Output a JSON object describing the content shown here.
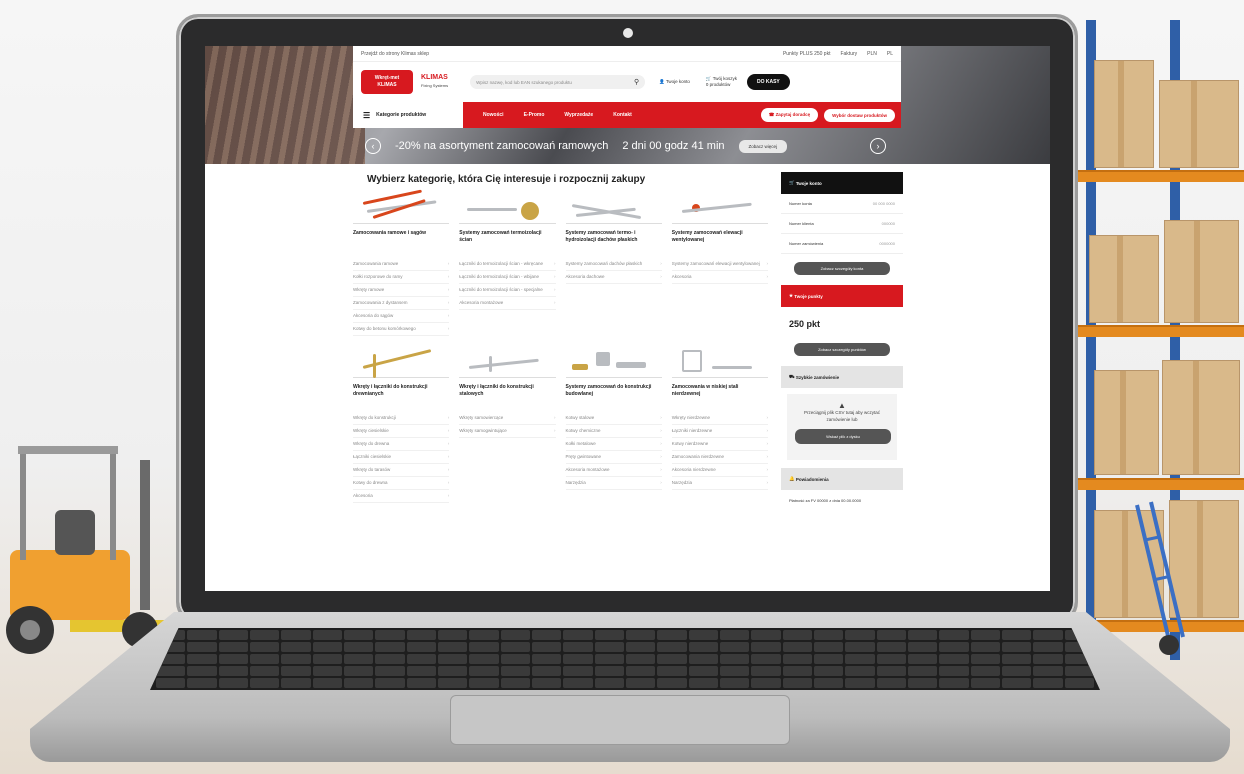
{
  "site": {
    "topbar": {
      "left": "Przejdź do strony Klimas sklep",
      "items": [
        "Punkty PLUS 250 pkt",
        "Faktury",
        "PLN",
        "PL"
      ]
    },
    "logo_main_line1": "Wkręt-met",
    "logo_main_line2": "KLIMAS",
    "logo_secondary": "KLIMAS",
    "logo_secondary_sub": "Fixing Systems",
    "search_placeholder": "Wpisz nazwę, kod lub EAN szukanego produktu",
    "account_link": "Twoje konto",
    "cart_line1": "Twój koszyk",
    "cart_line2": "0 produktów",
    "checkout_button": "DO KASY",
    "nav": {
      "categories_label": "Kategorie produktów",
      "links": [
        "Nowości",
        "E-Promo",
        "Wyprzedaże",
        "Kontakt"
      ],
      "pill_1": "Zapytaj doradcę",
      "pill_2": "Wybór dostaw produktów"
    },
    "promo": {
      "text": "-20% na asortyment zamocowań ramowych",
      "countdown": "2 dni 00 godz 41 min",
      "button": "Zobacz więcej"
    }
  },
  "main": {
    "title": "Wybierz kategorię, która Cię interesuje i rozpocznij zakupy",
    "categories_row1": [
      {
        "title": "Zamocowania ramowe i sągów",
        "items": [
          "Zamocowania ramowe",
          "Kołki rozporowe do ramy",
          "Wkręty ramowe",
          "Zamocowania z dystansem",
          "Akcesoria do sągów",
          "Kotwy do betonu komórkowego"
        ]
      },
      {
        "title": "Systemy zamocowań termoizolacji ścian",
        "items": [
          "Łączniki do termoizolacji ścian - wkręcane",
          "Łączniki do termoizolacji ścian - wbijane",
          "Łączniki do termoizolacji ścian - specjalne",
          "Akcesoria montażowe"
        ]
      },
      {
        "title": "Systemy zamocowań termo- i hydroizolacji dachów płaskich",
        "items": [
          "Systemy zamocowań dachów płaskich",
          "Akcesoria dachowe"
        ]
      },
      {
        "title": "Systemy zamocowań elewacji wentylowanej",
        "items": [
          "Systemy zamocowań elewacji wentylowanej",
          "Akcesoria"
        ]
      }
    ],
    "categories_row2": [
      {
        "title": "Wkręty i łączniki do konstrukcji drewnianych",
        "items": [
          "Wkręty do konstrukcji",
          "Wkręty ciesielskie",
          "Wkręty do drewna",
          "Łączniki ciesielskie",
          "Wkręty do tarasów",
          "Kotwy do drewna",
          "Akcesoria"
        ]
      },
      {
        "title": "Wkręty i łączniki do konstrukcji stalowych",
        "items": [
          "Wkręty samowiercące",
          "Wkręty samogwintujące"
        ]
      },
      {
        "title": "Systemy zamocowań do konstrukcji budowlanej",
        "items": [
          "Kotwy stalowe",
          "Kotwy chemiczne",
          "Kołki metalowe",
          "Pręty gwintowane",
          "Akcesoria montażowe",
          "Narzędzia"
        ]
      },
      {
        "title": "Zamocowania w niskiej stali nierdzewnej",
        "items": [
          "Wkręty nierdzewne",
          "Łączniki nierdzewne",
          "Kotwy nierdzewne",
          "Zamocowania nierdzewne",
          "Akcesoria nierdzewne",
          "Narzędzia"
        ]
      }
    ]
  },
  "sidebar": {
    "account_header": "Twoje konto",
    "rows": [
      {
        "label": "Numer konta",
        "value": "00 000 0000"
      },
      {
        "label": "Numer klienta",
        "value": "000000"
      },
      {
        "label": "Numer zamówienia",
        "value": "0000000"
      }
    ],
    "account_button": "Zobacz szczegóły konta",
    "points_header": "Twoje punkty",
    "points_value": "250 pkt",
    "points_button": "Zobacz szczegóły punktów",
    "order_header": "Szybkie zamówienie",
    "order_text": "Przeciągnij plik CSV tutaj aby wczytać zamówienie lub",
    "order_button": "Wskaż plik z dysku",
    "notif_header": "Powiadomienia",
    "notif_text": "Płatność za FV 00000 z dnia 00.00.0000"
  },
  "colors": {
    "brand_red": "#d7191f",
    "dark": "#111111"
  }
}
